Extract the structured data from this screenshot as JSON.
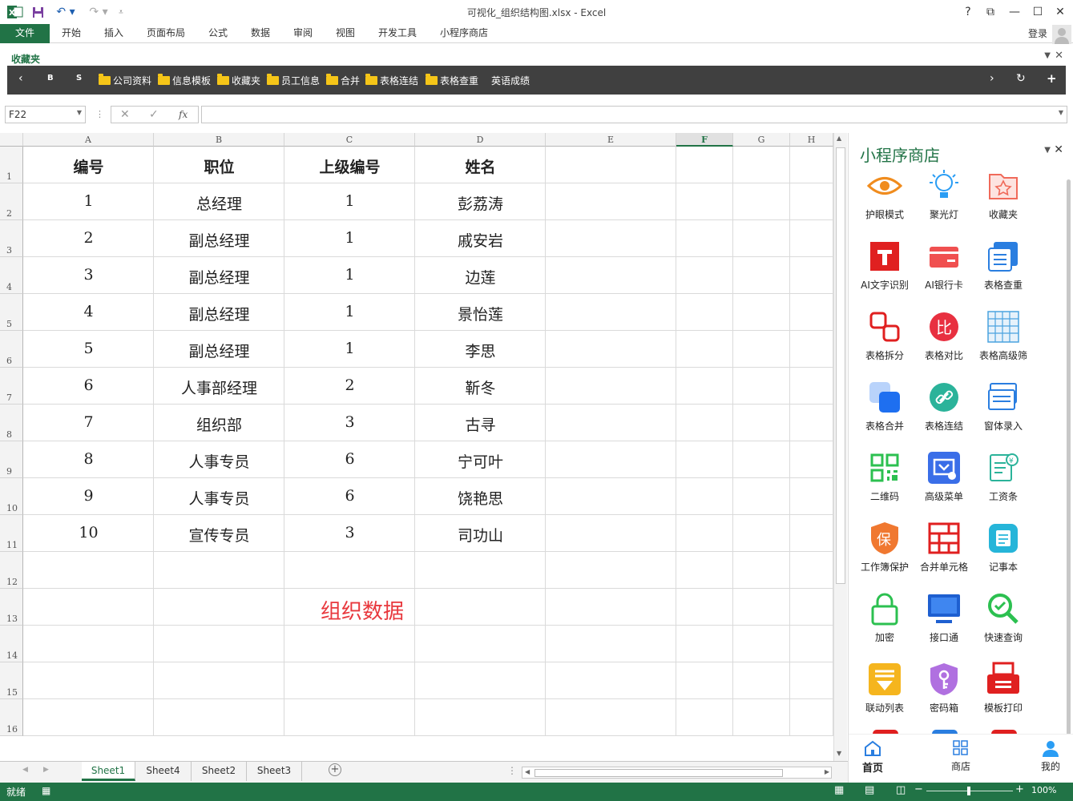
{
  "window": {
    "title": "可视化_组织结构图.xlsx - Excel",
    "help": "?",
    "restore_glyph": "⧉",
    "minimize_glyph": "—",
    "maximize_glyph": "☐",
    "close_glyph": "✕"
  },
  "ribbon": {
    "tabs": [
      "文件",
      "开始",
      "插入",
      "页面布局",
      "公式",
      "数据",
      "审阅",
      "视图",
      "开发工具",
      "小程序商店"
    ],
    "login": "登录"
  },
  "favorites": {
    "header": "收藏夹",
    "nav": [
      "B",
      "S"
    ],
    "items": [
      "公司资料",
      "信息模板",
      "收藏夹",
      "员工信息",
      "合并",
      "表格连结",
      "表格查重"
    ],
    "extra": "英语成绩"
  },
  "formula_bar": {
    "name_box": "F22",
    "fx": "fx",
    "value": ""
  },
  "grid": {
    "columns": [
      "A",
      "B",
      "C",
      "D",
      "E",
      "F",
      "G",
      "H"
    ],
    "selected_column": "F",
    "rows": [
      "1",
      "2",
      "3",
      "4",
      "5",
      "6",
      "7",
      "8",
      "9",
      "10",
      "11",
      "12",
      "13",
      "14",
      "15",
      "16"
    ],
    "header": [
      "编号",
      "职位",
      "上级编号",
      "姓名"
    ],
    "data": [
      [
        "1",
        "总经理",
        "1",
        "彭荔涛"
      ],
      [
        "2",
        "副总经理",
        "1",
        "戚安岩"
      ],
      [
        "3",
        "副总经理",
        "1",
        "边莲"
      ],
      [
        "4",
        "副总经理",
        "1",
        "景怡莲"
      ],
      [
        "5",
        "副总经理",
        "1",
        "李思"
      ],
      [
        "6",
        "人事部经理",
        "2",
        "靳冬"
      ],
      [
        "7",
        "组织部",
        "3",
        "古寻"
      ],
      [
        "8",
        "人事专员",
        "6",
        "宁可叶"
      ],
      [
        "9",
        "人事专员",
        "6",
        "饶艳思"
      ],
      [
        "10",
        "宣传专员",
        "3",
        "司功山"
      ]
    ],
    "overlay_label": "组织数据"
  },
  "sheets": {
    "tabs": [
      "Sheet1",
      "Sheet4",
      "Sheet2",
      "Sheet3"
    ],
    "active": "Sheet1",
    "add": "+"
  },
  "status": {
    "ready": "就绪",
    "zoom": "100%"
  },
  "panel": {
    "title": "小程序商店",
    "apps": [
      {
        "label": "护眼模式",
        "icon": "eye-icon",
        "color": "#f08c1e"
      },
      {
        "label": "聚光灯",
        "icon": "lightbulb-icon",
        "color": "#2a9df4"
      },
      {
        "label": "收藏夹",
        "icon": "star-folder-icon",
        "color": "#f06a5a"
      },
      {
        "label": "AI文字识别",
        "icon": "text-recognition-icon",
        "color": "#e02020"
      },
      {
        "label": "AI银行卡",
        "icon": "bank-card-icon",
        "color": "#f05050"
      },
      {
        "label": "表格查重",
        "icon": "table-duplicate-icon",
        "color": "#2a7ee0"
      },
      {
        "label": "表格拆分",
        "icon": "split-icon",
        "color": "#e02020"
      },
      {
        "label": "表格对比",
        "icon": "compare-icon",
        "color": "#e83040"
      },
      {
        "label": "表格高级筛选",
        "icon": "grid-filter-icon",
        "color": "#4aa3df"
      },
      {
        "label": "表格合并",
        "icon": "merge-icon",
        "color": "#1e6ff0"
      },
      {
        "label": "表格连结",
        "icon": "link-icon",
        "color": "#2bb39a"
      },
      {
        "label": "窗体录入",
        "icon": "form-icon",
        "color": "#2a7ee0"
      },
      {
        "label": "二维码",
        "icon": "qrcode-icon",
        "color": "#2cc050"
      },
      {
        "label": "高级菜单",
        "icon": "advanced-menu-icon",
        "color": "#3a6ee8"
      },
      {
        "label": "工资条",
        "icon": "payslip-icon",
        "color": "#2bb39a"
      },
      {
        "label": "工作簿保护",
        "icon": "shield-icon",
        "color": "#f07830"
      },
      {
        "label": "合并单元格",
        "icon": "merge-cells-icon",
        "color": "#e02020"
      },
      {
        "label": "记事本",
        "icon": "notepad-icon",
        "color": "#26b5d9"
      },
      {
        "label": "加密",
        "icon": "lock-icon",
        "color": "#2cc050"
      },
      {
        "label": "接口通",
        "icon": "monitor-icon",
        "color": "#1e5fd0"
      },
      {
        "label": "快速查询",
        "icon": "search-icon",
        "color": "#2cc050"
      },
      {
        "label": "联动列表",
        "icon": "linked-list-icon",
        "color": "#f5b51e"
      },
      {
        "label": "密码箱",
        "icon": "key-shield-icon",
        "color": "#b070e0"
      },
      {
        "label": "模板打印",
        "icon": "print-icon",
        "color": "#e02020"
      }
    ],
    "nav": [
      "首页",
      "商店",
      "我的"
    ]
  }
}
